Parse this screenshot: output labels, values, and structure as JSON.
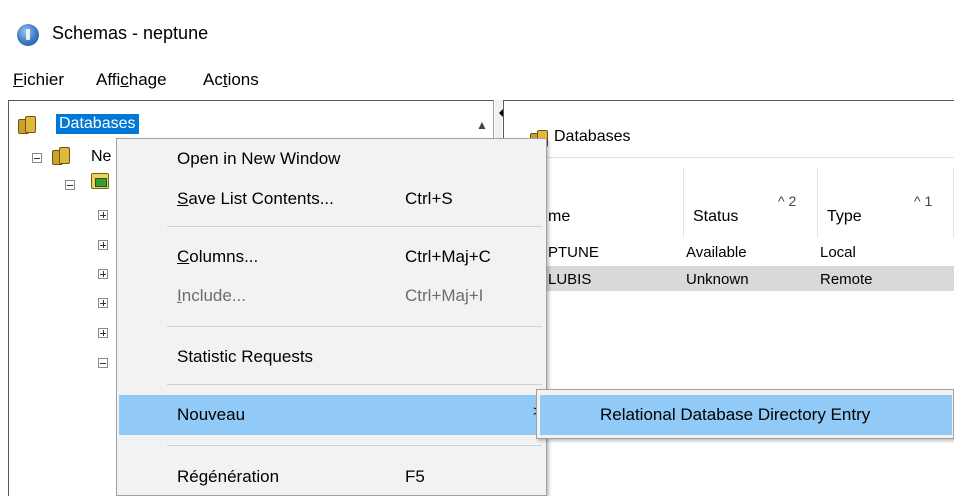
{
  "window": {
    "title": "Schemas - neptune",
    "icon": "app-globe-icon"
  },
  "menubar": [
    {
      "pre": "",
      "u": "F",
      "post": "ichier"
    },
    {
      "pre": "Affi",
      "u": "c",
      "post": "hage"
    },
    {
      "pre": "Ac",
      "u": "t",
      "post": "ions"
    }
  ],
  "tree": {
    "root_label": "Databases",
    "node1_label": "Ne"
  },
  "list": {
    "title": "Databases",
    "columns": [
      {
        "label": "me",
        "sort": ""
      },
      {
        "label": "Status",
        "sort": "^ 2"
      },
      {
        "label": "Type",
        "sort": "^ 1"
      }
    ],
    "rows": [
      [
        "PTUNE",
        "Available",
        "Local"
      ],
      [
        "LUBIS",
        "Unknown",
        "Remote"
      ]
    ]
  },
  "context_menu": {
    "open_new_window": "Open in New Window",
    "save_list": {
      "pre": "",
      "u": "S",
      "post": "ave List Contents...",
      "shortcut": "Ctrl+S"
    },
    "columns": {
      "pre": "",
      "u": "C",
      "post": "olumns...",
      "shortcut": "Ctrl+Maj+C"
    },
    "include": {
      "pre": "",
      "u": "I",
      "post": "nclude...",
      "shortcut": "Ctrl+Maj+I"
    },
    "statistic_requests": "Statistic Requests",
    "nouveau": "Nouveau",
    "submenu_arrow": ">",
    "regeneration": {
      "label": "Régénération",
      "shortcut": "F5"
    }
  },
  "submenu": {
    "item": "Relational Database Directory Entry"
  },
  "colors": {
    "selection": "#0078d7",
    "menu_highlight": "#91c9f7",
    "menu_bg": "#f2f2f2",
    "row_alt": "#d9d9d9"
  }
}
